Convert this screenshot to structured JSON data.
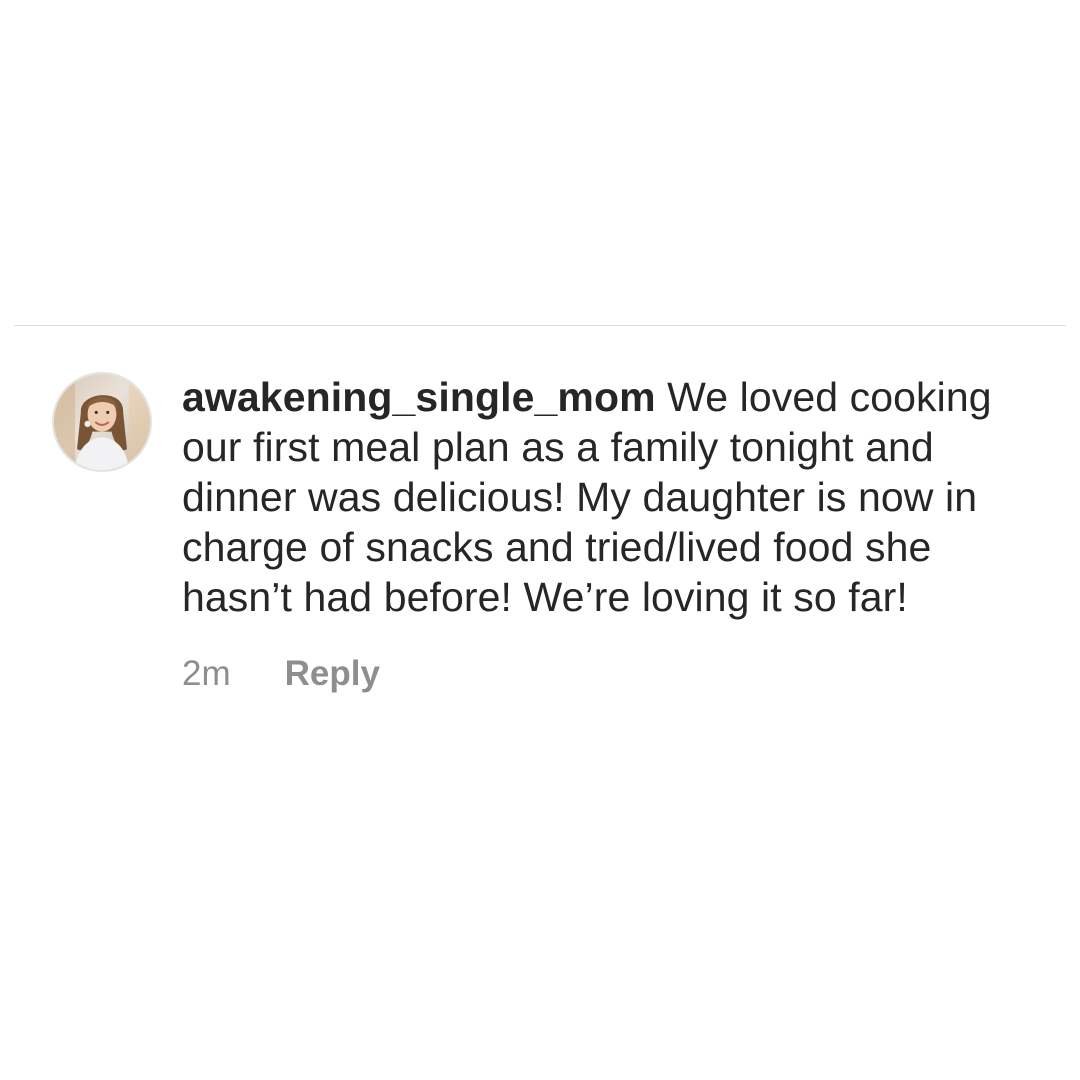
{
  "comment": {
    "username": "awakening_single_mom",
    "text": "We loved cooking our first meal plan as a family tonight and dinner was delicious! My daughter is now in charge of snacks and tried/lived food she hasn’t had before! We’re loving it so far!",
    "timestamp": "2m",
    "reply_label": "Reply",
    "avatar_icon": "user-profile-photo"
  },
  "colors": {
    "text": "#262626",
    "secondary_text": "#8e8e8e",
    "divider": "#dbdbdb",
    "background": "#ffffff"
  }
}
